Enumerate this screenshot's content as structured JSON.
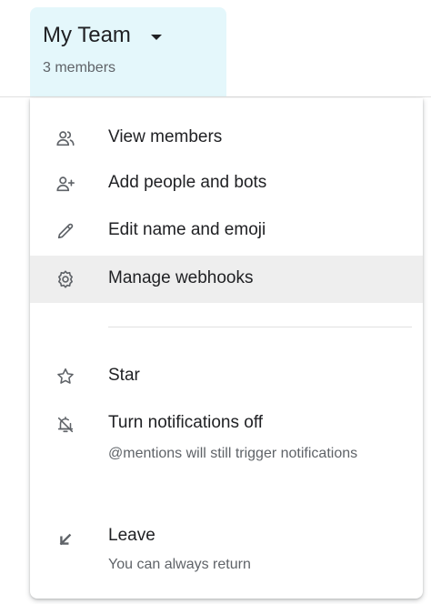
{
  "header": {
    "title": "My Team",
    "subtitle": "3 members",
    "background_color": "#e4f7fb",
    "caret_icon": "arrow-drop-down-icon"
  },
  "menu": {
    "items": [
      {
        "label": "View members",
        "icon": "people-icon"
      },
      {
        "label": "Add people and bots",
        "icon": "person-add-icon"
      },
      {
        "label": "Edit name and emoji",
        "icon": "pencil-icon"
      },
      {
        "label": "Manage webhooks",
        "icon": "gear-icon",
        "highlighted": true
      }
    ],
    "secondary_items": [
      {
        "label": "Star",
        "icon": "star-outline-icon"
      },
      {
        "label": "Turn notifications off",
        "description": "@mentions will still trigger notifications",
        "icon": "bell-off-icon"
      },
      {
        "label": "Leave",
        "description": "You can always return",
        "icon": "leave-arrow-icon"
      }
    ],
    "highlight_color": "#eeeeee"
  }
}
